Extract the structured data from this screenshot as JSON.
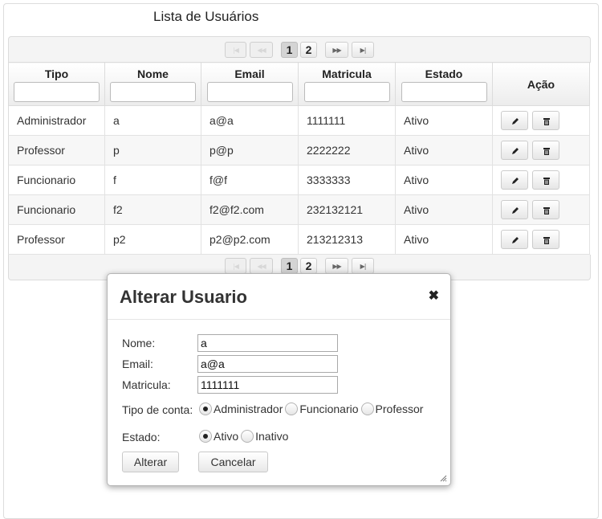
{
  "page": {
    "title": "Lista de Usuários"
  },
  "paginator": {
    "first_icon": "first-page-icon",
    "prev_icon": "prev-page-icon",
    "next_icon": "next-page-icon",
    "last_icon": "last-page-icon",
    "pages": [
      "1",
      "2"
    ],
    "current_page": "1"
  },
  "table": {
    "columns": [
      "Tipo",
      "Nome",
      "Email",
      "Matricula",
      "Estado",
      "Ação"
    ],
    "rows": [
      [
        "Administrador",
        "a",
        "a@a",
        "1111111",
        "Ativo"
      ],
      [
        "Professor",
        "p",
        "p@p",
        "2222222",
        "Ativo"
      ],
      [
        "Funcionario",
        "f",
        "f@f",
        "3333333",
        "Ativo"
      ],
      [
        "Funcionario",
        "f2",
        "f2@f2.com",
        "232132121",
        "Ativo"
      ],
      [
        "Professor",
        "p2",
        "p2@p2.com",
        "213212313",
        "Ativo"
      ]
    ],
    "row_actions": [
      "pencil-icon",
      "trash-icon"
    ]
  },
  "dialog": {
    "title": "Alterar Usuario",
    "close_icon": "close-icon",
    "fields": {
      "nome": {
        "label": "Nome:",
        "value": "a"
      },
      "email": {
        "label": "Email:",
        "value": "a@a"
      },
      "matricula": {
        "label": "Matricula:",
        "value": "1111111"
      }
    },
    "tipo_conta": {
      "label": "Tipo de conta:",
      "options": [
        "Administrador",
        "Funcionario",
        "Professor"
      ],
      "selected": "Administrador"
    },
    "estado": {
      "label": "Estado:",
      "options": [
        "Ativo",
        "Inativo"
      ],
      "selected": "Ativo"
    },
    "buttons": {
      "submit": "Alterar",
      "cancel": "Cancelar"
    }
  }
}
